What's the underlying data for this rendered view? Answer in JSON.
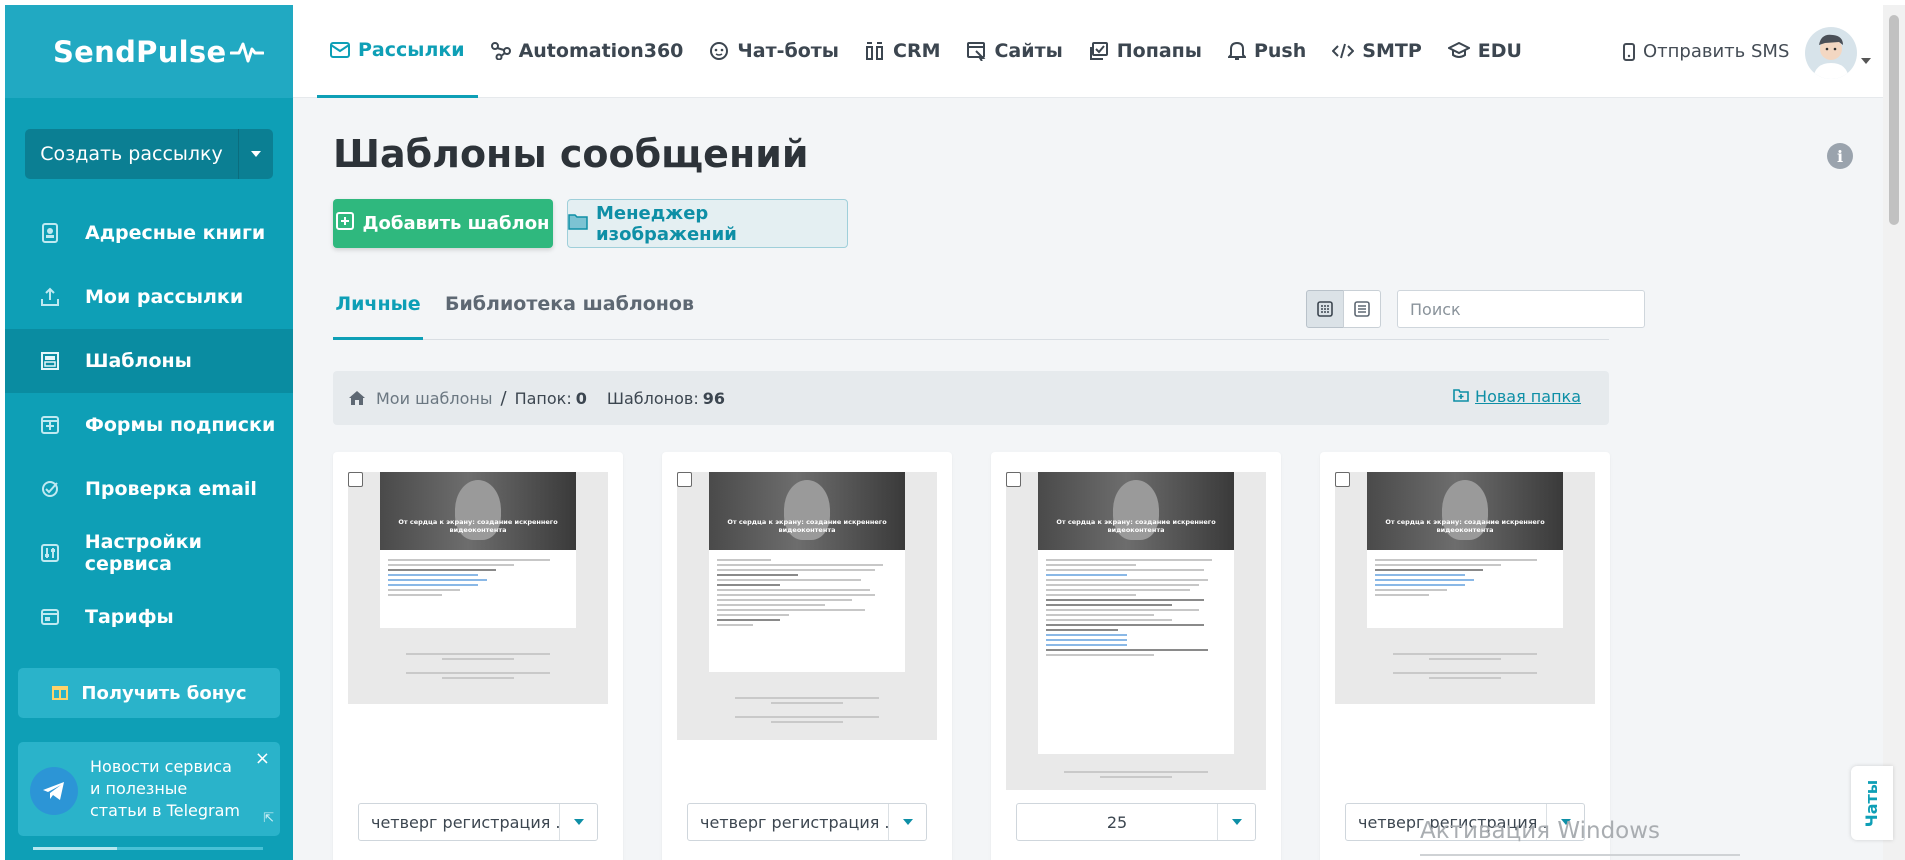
{
  "sidebar": {
    "brand": "SendPulse",
    "create_button": "Создать рассылку",
    "items": [
      {
        "label": "Адресные книги",
        "icon": "address-book-icon"
      },
      {
        "label": "Мои рассылки",
        "icon": "campaigns-icon"
      },
      {
        "label": "Шаблоны",
        "icon": "templates-icon"
      },
      {
        "label": "Формы подписки",
        "icon": "forms-icon"
      },
      {
        "label": "Проверка email",
        "icon": "email-check-icon"
      },
      {
        "label": "Настройки сервиса",
        "icon": "settings-icon"
      },
      {
        "label": "Тарифы",
        "icon": "pricing-icon"
      }
    ],
    "active_index": 2,
    "bonus_button": "Получить бонус",
    "telegram_text": "Новости сервиса и полезные статьи в Telegram",
    "close": "×",
    "collapse": "⇱"
  },
  "topnav": {
    "items": [
      {
        "label": "Рассылки",
        "icon": "mail-icon"
      },
      {
        "label": "Automation360",
        "icon": "automation-icon"
      },
      {
        "label": "Чат-боты",
        "icon": "chatbot-icon"
      },
      {
        "label": "CRM",
        "icon": "crm-icon"
      },
      {
        "label": "Сайты",
        "icon": "sites-icon"
      },
      {
        "label": "Попапы",
        "icon": "popups-icon"
      },
      {
        "label": "Push",
        "icon": "bell-icon"
      },
      {
        "label": "SMTP",
        "icon": "code-icon"
      },
      {
        "label": "EDU",
        "icon": "graduation-cap-icon"
      }
    ],
    "active_index": 0,
    "sms_label": "Отправить SMS"
  },
  "main": {
    "title": "Шаблоны сообщений",
    "add_template": "Добавить шаблон",
    "image_manager": "Менеджер изображений",
    "tabs": [
      "Личные",
      "Библиотека шаблонов"
    ],
    "search_placeholder": "Поиск",
    "breadcrumb": {
      "root": "Мои шаблоны",
      "sep": "/",
      "folders_label": "Папок:",
      "folders_count": "0",
      "templates_label": "Шаблонов:",
      "templates_count": "96",
      "new_folder": "Новая папка"
    },
    "cards": [
      {
        "select_value": "четверг регистрация ..."
      },
      {
        "select_value": "четверг регистрация ..."
      },
      {
        "select_value": "25"
      },
      {
        "select_value": "четверг регистрация ..."
      }
    ],
    "preview_title": "От сердца к экрану: создание искреннего видеоконтента"
  },
  "overlay": {
    "windows_activation": "Активация Windows",
    "chats_tab": "Чаты"
  },
  "colors": {
    "sidebar": "#0e9fb6",
    "accent": "#0e9fb6",
    "add_button": "#2fb87e"
  }
}
